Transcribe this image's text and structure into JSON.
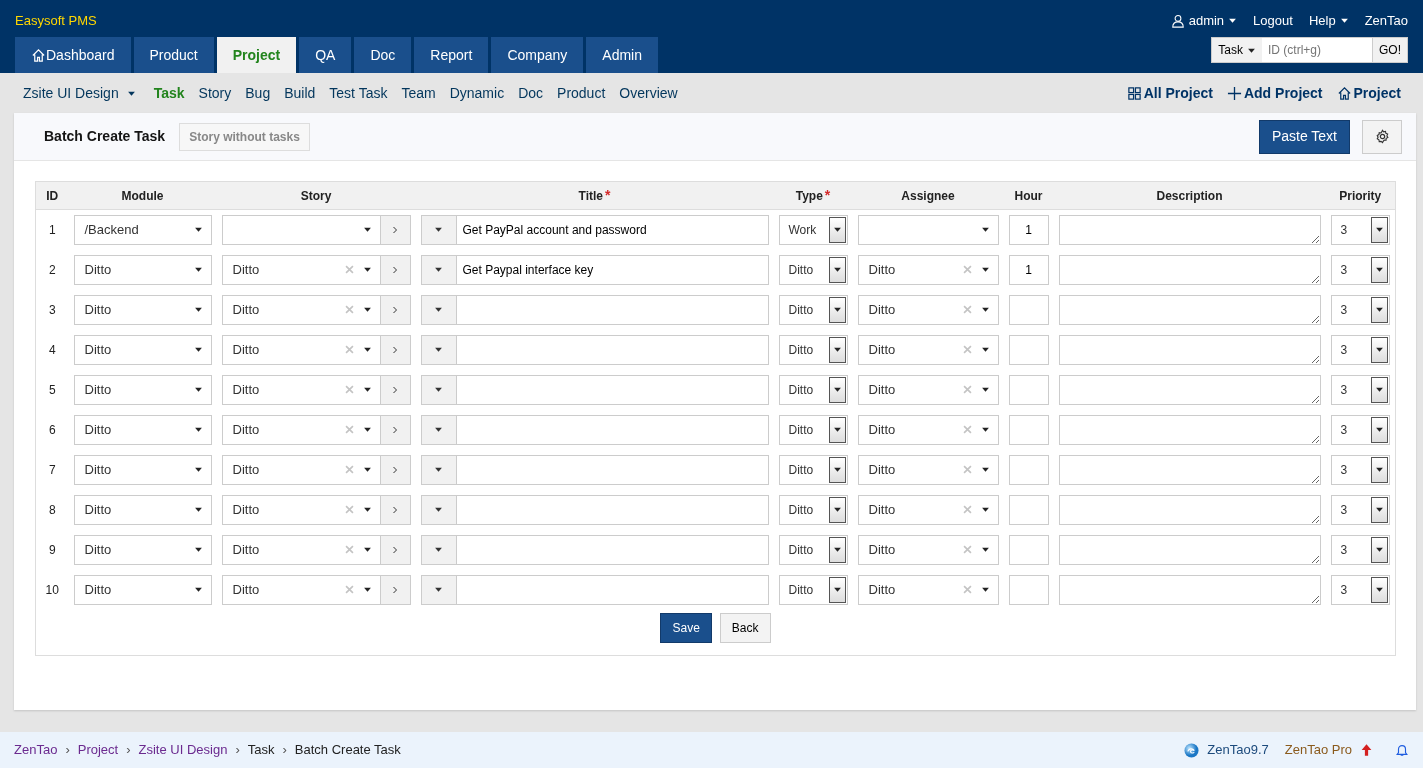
{
  "brand": "Easysoft PMS",
  "user_menu": {
    "user": "admin",
    "logout": "Logout",
    "help": "Help",
    "about": "ZenTao"
  },
  "main_tabs": [
    {
      "label": "Dashboard",
      "selected": false
    },
    {
      "label": "Product",
      "selected": false
    },
    {
      "label": "Project",
      "selected": true
    },
    {
      "label": "QA",
      "selected": false
    },
    {
      "label": "Doc",
      "selected": false
    },
    {
      "label": "Report",
      "selected": false
    },
    {
      "label": "Company",
      "selected": false
    },
    {
      "label": "Admin",
      "selected": false
    }
  ],
  "quick_search": {
    "type": "Task",
    "placeholder": "ID (ctrl+g)",
    "button": "GO!"
  },
  "project_switcher": "Zsite UI Design",
  "sub_nav": [
    {
      "label": "Task",
      "selected": true
    },
    {
      "label": "Story",
      "selected": false
    },
    {
      "label": "Bug",
      "selected": false
    },
    {
      "label": "Build",
      "selected": false
    },
    {
      "label": "Test Task",
      "selected": false
    },
    {
      "label": "Team",
      "selected": false
    },
    {
      "label": "Dynamic",
      "selected": false
    },
    {
      "label": "Doc",
      "selected": false
    },
    {
      "label": "Product",
      "selected": false
    },
    {
      "label": "Overview",
      "selected": false
    }
  ],
  "sub_actions": [
    {
      "label": "All Project"
    },
    {
      "label": "Add Project"
    },
    {
      "label": "Project"
    }
  ],
  "panel": {
    "title": "Batch Create Task",
    "story_button": "Story without tasks",
    "paste_button": "Paste Text"
  },
  "table": {
    "columns": [
      {
        "label": "ID"
      },
      {
        "label": "Module"
      },
      {
        "label": "Story"
      },
      {
        "label": "Title",
        "required_mark": "*"
      },
      {
        "label": "Type",
        "required_mark": "*"
      },
      {
        "label": "Assignee"
      },
      {
        "label": "Hour"
      },
      {
        "label": "Description"
      },
      {
        "label": "Priority"
      }
    ],
    "rows": [
      {
        "id": "1",
        "module": "/Backend",
        "story": "",
        "title": "Get PayPal account and password",
        "type": "Work",
        "assignee": "",
        "hour": "1",
        "priority": "3"
      },
      {
        "id": "2",
        "module": "Ditto",
        "story": "Ditto",
        "title": "Get Paypal interface key",
        "type": "Ditto",
        "assignee": "Ditto",
        "hour": "1",
        "priority": "3"
      },
      {
        "id": "3",
        "module": "Ditto",
        "story": "Ditto",
        "title": "",
        "type": "Ditto",
        "assignee": "Ditto",
        "hour": "",
        "priority": "3"
      },
      {
        "id": "4",
        "module": "Ditto",
        "story": "Ditto",
        "title": "",
        "type": "Ditto",
        "assignee": "Ditto",
        "hour": "",
        "priority": "3"
      },
      {
        "id": "5",
        "module": "Ditto",
        "story": "Ditto",
        "title": "",
        "type": "Ditto",
        "assignee": "Ditto",
        "hour": "",
        "priority": "3"
      },
      {
        "id": "6",
        "module": "Ditto",
        "story": "Ditto",
        "title": "",
        "type": "Ditto",
        "assignee": "Ditto",
        "hour": "",
        "priority": "3"
      },
      {
        "id": "7",
        "module": "Ditto",
        "story": "Ditto",
        "title": "",
        "type": "Ditto",
        "assignee": "Ditto",
        "hour": "",
        "priority": "3"
      },
      {
        "id": "8",
        "module": "Ditto",
        "story": "Ditto",
        "title": "",
        "type": "Ditto",
        "assignee": "Ditto",
        "hour": "",
        "priority": "3"
      },
      {
        "id": "9",
        "module": "Ditto",
        "story": "Ditto",
        "title": "",
        "type": "Ditto",
        "assignee": "Ditto",
        "hour": "",
        "priority": "3"
      },
      {
        "id": "10",
        "module": "Ditto",
        "story": "Ditto",
        "title": "",
        "type": "Ditto",
        "assignee": "Ditto",
        "hour": "",
        "priority": "3"
      }
    ]
  },
  "form_buttons": {
    "save": "Save",
    "back": "Back"
  },
  "breadcrumb": [
    {
      "label": "ZenTao",
      "link": true
    },
    {
      "separator": "›",
      "label": "Project",
      "link": true
    },
    {
      "separator": "›",
      "label": "Zsite UI Design",
      "link": true
    },
    {
      "separator": "›",
      "label": "Task",
      "link": false
    },
    {
      "separator": "›",
      "label": "Batch Create Task",
      "link": false
    }
  ],
  "footer": {
    "version": "ZenTao9.7",
    "pro": "ZenTao Pro"
  }
}
